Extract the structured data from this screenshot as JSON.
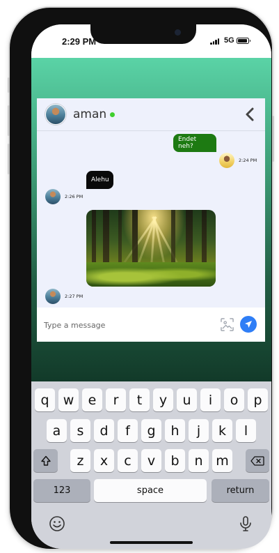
{
  "status_bar": {
    "time": "2:29 PM",
    "network": "5G"
  },
  "chat": {
    "contact_name": "aman",
    "messages": [
      {
        "direction": "outgoing",
        "text": "Endet neh?",
        "time": "2:24 PM"
      },
      {
        "direction": "incoming",
        "text": "Alehu",
        "time": "2:26 PM"
      },
      {
        "direction": "incoming",
        "image": "forest-sunlight",
        "time": "2:27 PM"
      }
    ],
    "input": {
      "placeholder": "Type a message",
      "value": ""
    }
  },
  "keyboard": {
    "row1": [
      "q",
      "w",
      "e",
      "r",
      "t",
      "y",
      "u",
      "i",
      "o",
      "p"
    ],
    "row2": [
      "a",
      "s",
      "d",
      "f",
      "g",
      "h",
      "j",
      "k",
      "l"
    ],
    "row3": [
      "z",
      "x",
      "c",
      "v",
      "b",
      "n",
      "m"
    ],
    "numbers_label": "123",
    "space_label": "space",
    "return_label": "return"
  },
  "colors": {
    "outgoing_bubble": "#1d7a12",
    "incoming_bubble": "#0a0a0a",
    "send_button": "#2f7ef6",
    "online": "#3fcf2e"
  }
}
